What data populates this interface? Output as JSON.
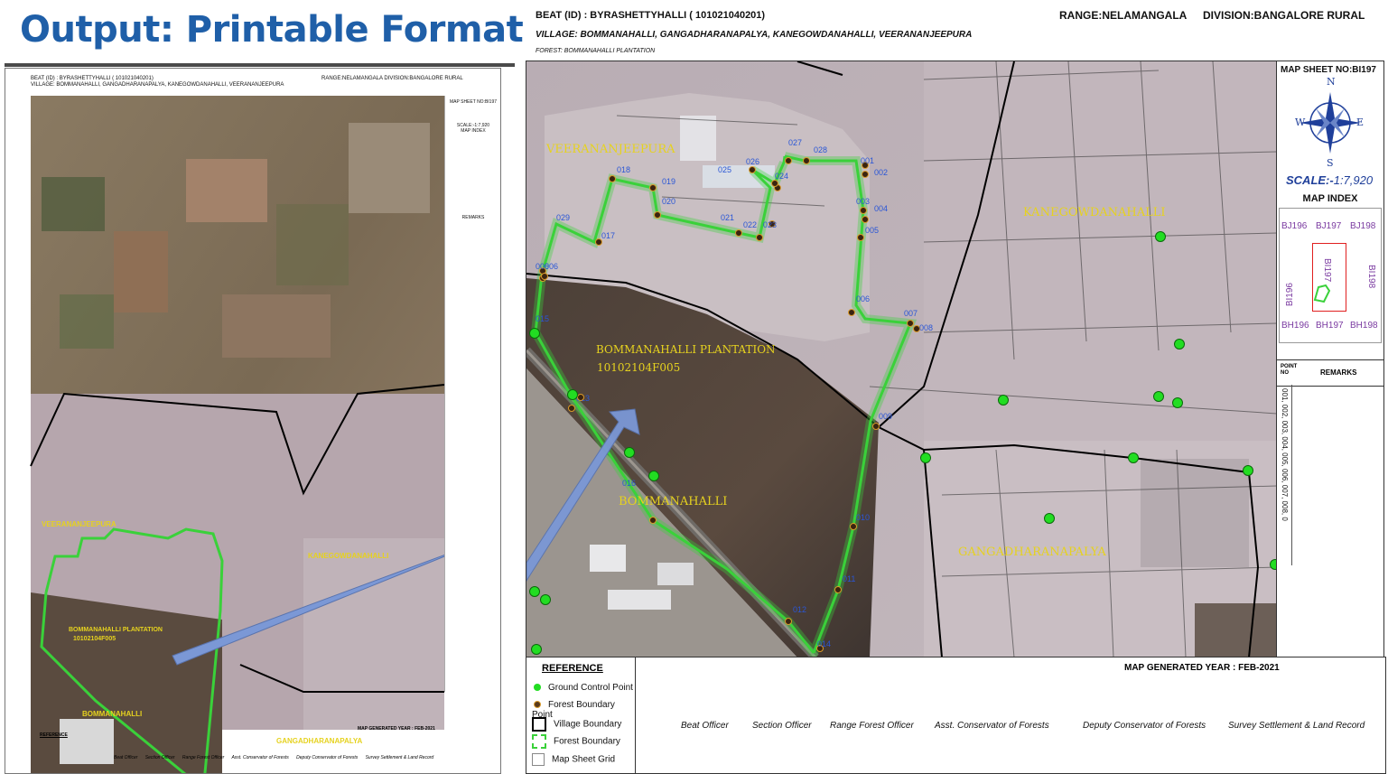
{
  "slide": {
    "title": "Output: Printable Format"
  },
  "sheet": {
    "beat": "BEAT (ID) : BYRASHETTYHALLI ( 101021040201)",
    "range": "RANGE:NELAMANGALA",
    "division": "DIVISION:BANGALORE RURAL",
    "village": "VILLAGE: BOMMANAHALLI, GANGADHARANAPALYA, KANEGOWDANAHALLI, VEERANANJEEPURA",
    "forest": "FOREST: BOMMANAHALLI PLANTATION",
    "map_sheet_no": "MAP SHEET NO:BI197",
    "compass": {
      "n": "N",
      "s": "S",
      "e": "E",
      "w": "W"
    },
    "scale_label": "SCALE:-",
    "scale_value": "1:7,920",
    "map_index_title": "MAP INDEX",
    "map_index": {
      "top": [
        "BJ196",
        "BJ197",
        "BJ198"
      ],
      "left": "BI196",
      "center": "BI197",
      "right": "BI198",
      "bottom": [
        "BH196",
        "BH197",
        "BH198"
      ]
    },
    "remarks_point": "POINT NO",
    "remarks_title": "REMARKS",
    "remarks_points": "001, 002, 003, 004, 005, 006, 007, 008, 0",
    "map_labels": {
      "veerananjeepura": "VEERANANJEEPURA",
      "kanegowdanahalli": "KANEGOWDANAHALLI",
      "plantation": "BOMMANAHALLI PLANTATION",
      "plantation_id": "10102104F005",
      "bommanahalli": "BOMMANAHALLI",
      "gangadharanapalya": "GANGADHARANAPALYA"
    },
    "point_labels": [
      "001",
      "002",
      "003",
      "004",
      "005",
      "006",
      "007",
      "008",
      "009",
      "010",
      "011",
      "012",
      "014",
      "013",
      "016",
      "017",
      "018",
      "019",
      "020",
      "021",
      "022",
      "023",
      "024",
      "025",
      "026",
      "027",
      "028",
      "029",
      "006",
      "015",
      "006"
    ],
    "legend": {
      "title": "REFERENCE",
      "items": [
        "Ground Control Point",
        "Forest Boundary Point",
        "Village Boundary",
        "Forest Boundary",
        "Map Sheet Grid"
      ]
    },
    "year": "MAP GENERATED YEAR : FEB-2021",
    "signatures": [
      "Beat Officer",
      "Section Officer",
      "Range Forest Officer",
      "Asst. Conservator  of Forests",
      "Deputy Conservator of Forests",
      "Survey Settlement & Land Record"
    ]
  },
  "thumbnail": {
    "beat": "BEAT (ID) : BYRASHETTYHALLI ( 101021040201)",
    "village": "VILLAGE: BOMMANAHALLI, GANGADHARANAPALYA, KANEGOWDANAHALLI, VEERANANJEEPURA",
    "range": "RANGE:NELAMANGALA   DIVISION:BANGALORE RURAL",
    "map_sheet_no": "MAP SHEET NO:BI197",
    "scale": "SCALE:-1:7,920",
    "map_index": "MAP INDEX",
    "remarks": "REMARKS",
    "year": "MAP GENERATED YEAR : FEB-2021",
    "veerananjeepura": "VEERANANJEEPURA",
    "kanegowdanahalli": "KANEGOWDANAHALLI",
    "plantation": "BOMMANAHALLI PLANTATION",
    "plantation_id": "10102104F005",
    "bommanahalli": "BOMMANAHALLI",
    "gangadharanapalya": "GANGADHARANAPALYA",
    "legend_title": "REFERENCE",
    "signatures": [
      "Beat Officer",
      "Section Officer",
      "Range Forest Officer",
      "Asst. Conservator of Forests",
      "Deputy Conservator of Forests",
      "Survey Settlement & Land Record"
    ]
  },
  "colors": {
    "title": "#1f5fa8",
    "forest_boundary": "#3ad13a",
    "gcp": "#22dd22",
    "label": "#e6d21f",
    "arrow": "#7b98d6"
  }
}
